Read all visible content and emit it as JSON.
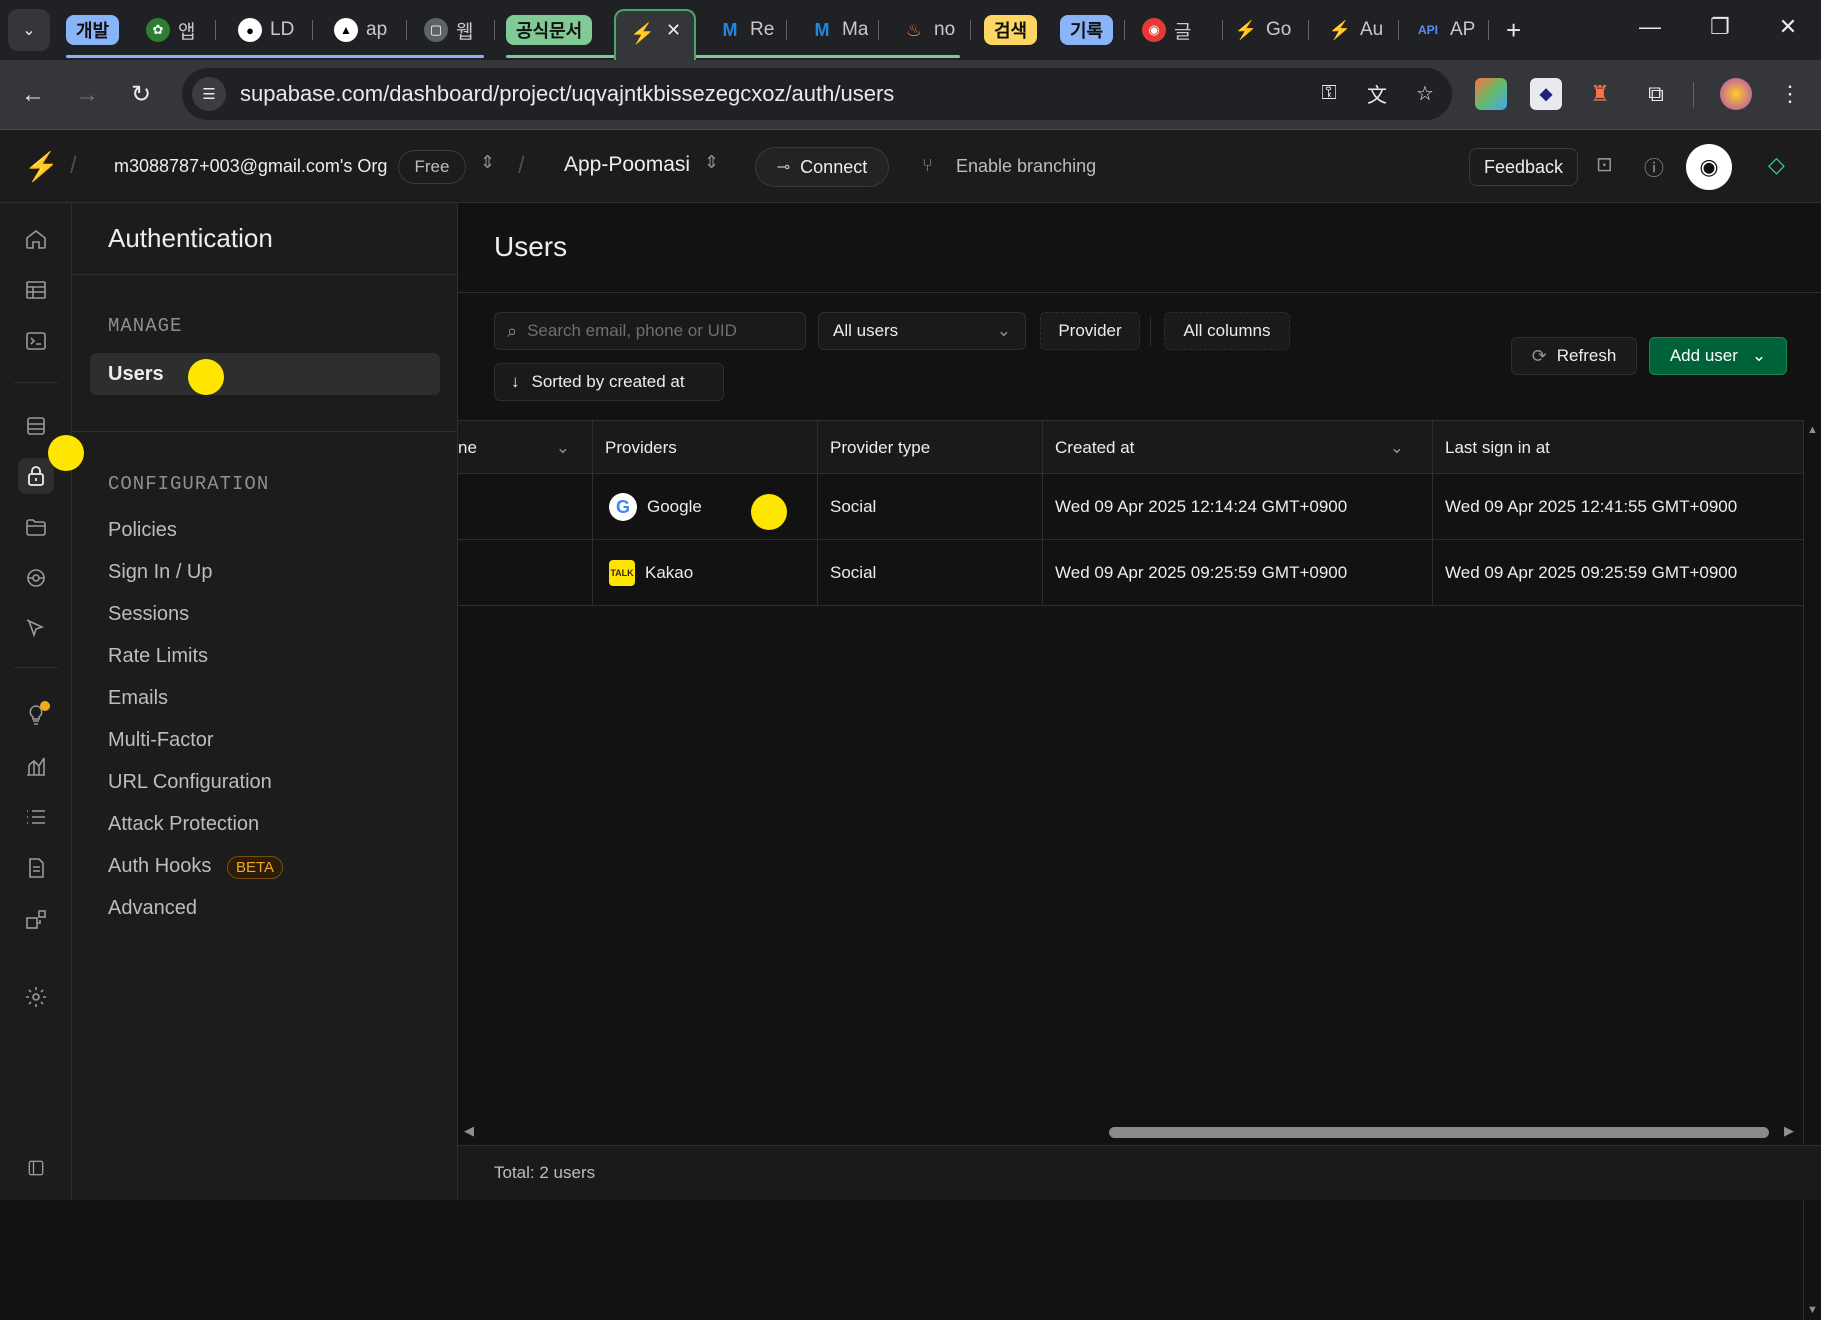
{
  "browser": {
    "tab_groups": {
      "dev": "개발",
      "official_docs": "공식문서",
      "search": "검색",
      "records": "기록"
    },
    "tabs": [
      {
        "label": "앱"
      },
      {
        "label": "LD"
      },
      {
        "label": "ap"
      },
      {
        "label": "웹"
      },
      {
        "label": "Re"
      },
      {
        "label": "Ma"
      },
      {
        "label": "no"
      },
      {
        "label": "글"
      },
      {
        "label": "Go"
      },
      {
        "label": "Au"
      },
      {
        "label": "AP"
      }
    ],
    "active_tab_close": "✕",
    "new_tab": "+",
    "url": "supabase.com/dashboard/project/uqvajntkbissezegcxoz/auth/users"
  },
  "header": {
    "org_name": "m3088787+003@gmail.com's Org",
    "plan_badge": "Free",
    "project_name": "App-Poomasi",
    "connect_label": "Connect",
    "branching_label": "Enable branching",
    "feedback_label": "Feedback"
  },
  "sidebar": {
    "title": "Authentication",
    "manage_section": "MANAGE",
    "manage_items": [
      {
        "label": "Users"
      }
    ],
    "config_section": "CONFIGURATION",
    "config_items": [
      {
        "label": "Policies"
      },
      {
        "label": "Sign In / Up"
      },
      {
        "label": "Sessions"
      },
      {
        "label": "Rate Limits"
      },
      {
        "label": "Emails"
      },
      {
        "label": "Multi-Factor"
      },
      {
        "label": "URL Configuration"
      },
      {
        "label": "Attack Protection"
      },
      {
        "label": "Auth Hooks",
        "badge": "BETA"
      },
      {
        "label": "Advanced"
      }
    ]
  },
  "main": {
    "page_title": "Users",
    "search_placeholder": "Search email, phone or UID",
    "filter_users": "All users",
    "provider_filter": "Provider",
    "columns_filter": "All columns",
    "sort_label": "Sorted by created at",
    "refresh_label": "Refresh",
    "add_user_label": "Add user",
    "table": {
      "columns": [
        "ne",
        "Providers",
        "Provider type",
        "Created at",
        "Last sign in at"
      ],
      "rows": [
        {
          "provider": "Google",
          "provider_type": "Social",
          "created_at": "Wed 09 Apr 2025 12:14:24 GMT+0900",
          "last_sign_in": "Wed 09 Apr 2025 12:41:55 GMT+0900"
        },
        {
          "provider": "Kakao",
          "provider_type": "Social",
          "created_at": "Wed 09 Apr 2025 09:25:59 GMT+0900",
          "last_sign_in": "Wed 09 Apr 2025 09:25:59 GMT+0900"
        }
      ]
    },
    "total_label": "Total: 2 users"
  },
  "colors": {
    "brand_green": "#3ecf8e",
    "add_user_bg": "#006239",
    "beta_badge": "#f5a623",
    "highlight_dot": "#ffe600"
  }
}
